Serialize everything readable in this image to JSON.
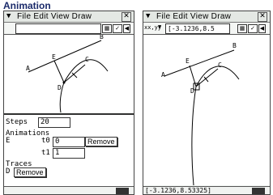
{
  "page_title": "Animation",
  "menu": {
    "arrow": "▼",
    "items": "File Edit View Draw",
    "close": "✕"
  },
  "left": {
    "toolbar_field": "",
    "panel": {
      "steps_label": "Steps",
      "steps_value": "20",
      "animations_label": "Animations",
      "anim_point": "E",
      "t0_label": "t0",
      "t0_value": "0",
      "t1_label": "t1",
      "t1_value": "1",
      "remove_label": "Remove",
      "traces_label": "Traces",
      "trace_point": "D",
      "trace_remove_label": "Remove"
    }
  },
  "right": {
    "selector_label": "xx,yy",
    "toolbar_field": "[-3.1236,8.5",
    "status_text": "[-3.1236,8.53325]"
  },
  "points": {
    "A": "A",
    "B": "B",
    "C": "C",
    "D": "D",
    "E": "E"
  },
  "icons": {
    "grid": "▦",
    "check": "✓",
    "left": "◀"
  }
}
